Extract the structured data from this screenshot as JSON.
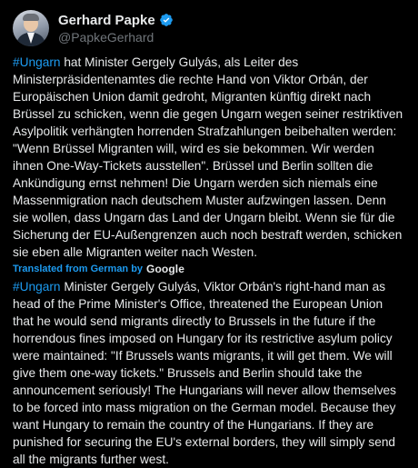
{
  "author": {
    "display_name": "Gerhard Papke",
    "handle": "@PapkeGerhard"
  },
  "tweet": {
    "original": {
      "hashtag": "#Ungarn",
      "text": " hat Minister Gergely Gulyás, als Leiter des Ministerpräsidentenamtes die rechte Hand von Viktor Orbán, der Europäischen Union damit gedroht, Migranten künftig direkt nach Brüssel zu schicken, wenn die gegen Ungarn wegen seiner restriktiven Asylpolitik verhängten horrenden Strafzahlungen beibehalten werden: \"Wenn Brüssel Migranten will, wird es sie bekommen. Wir werden ihnen One-Way-Tickets ausstellen\". Brüssel und Berlin sollten die Ankündigung ernst nehmen! Die Ungarn werden sich niemals eine Massenmigration nach deutschem Muster aufzwingen lassen. Denn sie wollen, dass Ungarn das Land der Ungarn bleibt. Wenn sie für die Sicherung der EU-Außengrenzen auch noch bestraft werden, schicken sie eben alle Migranten weiter nach Westen."
    },
    "translation_label": "Translated from German by",
    "translation_provider": "Google",
    "translated": {
      "hashtag": "#Ungarn",
      "text": " Minister Gergely Gulyás, Viktor Orbán's right-hand man as head of the Prime Minister's Office, threatened the European Union that he would send migrants directly to Brussels in the future if the horrendous fines imposed on Hungary for its restrictive asylum policy were maintained: \"If Brussels wants migrants, it will get them. We will give them one-way tickets.\" Brussels and Berlin should take the announcement seriously! The Hungarians will never allow themselves to be forced into mass migration on the German model. Because they want Hungary to remain the country of the Hungarians. If they are punished for securing the EU's external borders, they will simply send all the migrants further west."
    }
  },
  "colors": {
    "background": "#000000",
    "text": "#e7e9ea",
    "secondary": "#71767b",
    "accent": "#1d9bf0"
  },
  "icons": {
    "verified": "verified-badge-icon"
  }
}
